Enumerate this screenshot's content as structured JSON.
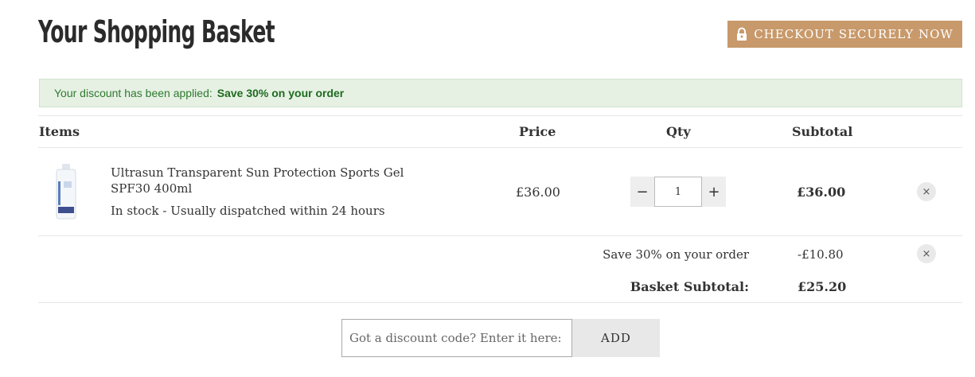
{
  "page": {
    "title": "Your Shopping Basket"
  },
  "checkout": {
    "label": "CHECKOUT SECURELY NOW",
    "icon": "lock-icon",
    "color": "#c8996a"
  },
  "notice": {
    "text": "Your discount has been applied:",
    "highlight": "Save 30% on your order",
    "color": "#e6f1e4"
  },
  "table": {
    "headers": {
      "items": "Items",
      "price": "Price",
      "qty": "Qty",
      "subtotal": "Subtotal"
    }
  },
  "item": {
    "name": "Ultrasun Transparent Sun Protection Sports Gel SPF30 400ml",
    "stock": "In stock  -  Usually dispatched within 24 hours",
    "price": "£36.00",
    "qty": "1",
    "subtotal": "£36.00",
    "remove": "×"
  },
  "qty_controls": {
    "minus": "−",
    "plus": "+"
  },
  "discount": {
    "label": "Save 30% on your order",
    "value": "-£10.80",
    "remove": "×"
  },
  "basket": {
    "label": "Basket Subtotal:",
    "value": "£25.20"
  },
  "code": {
    "placeholder": "Got a discount code? Enter it here:",
    "button": "ADD"
  }
}
